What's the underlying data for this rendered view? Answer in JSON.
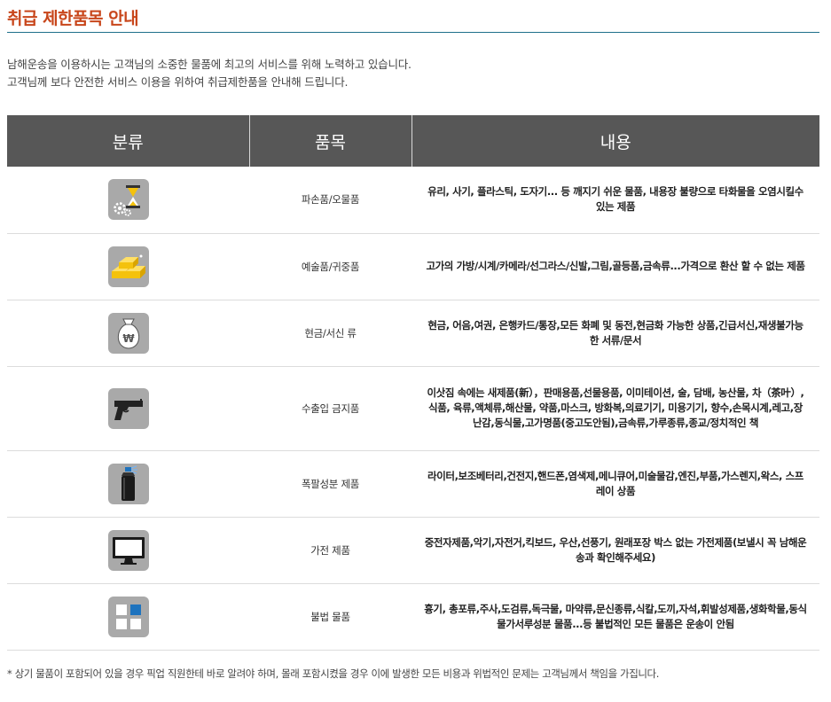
{
  "title": "취급 제한품목 안내",
  "intro": {
    "line1": "남해운송을 이용하시는 고객님의 소중한 물품에 최고의 서비스를 위해 노력하고 있습니다.",
    "line2": "고객님께 보다 안전한 서비스 이용을 위하여 취급제한품을 안내해 드립니다."
  },
  "table": {
    "headers": [
      "분류",
      "품목",
      "내용"
    ],
    "rows": [
      {
        "icon": "hourglass-gear-icon",
        "item": "파손품/오물품",
        "desc": "유리, 사기, 플라스틱, 도자기... 등 깨지기 쉬운 물품, 내용장 불량으로 타화물을 오염시킬수 있는 제품"
      },
      {
        "icon": "gold-bars-icon",
        "item": "예술품/귀중품",
        "desc": "고가의 가방/시계/카메라/선그라스/신발,그림,골등품,금속류...가격으로 환산 할 수 없는 제품"
      },
      {
        "icon": "money-bag-icon",
        "item": "현금/서신 류",
        "desc": "현금, 어음,여권, 은행카드/통장,모든 화폐 및 동전,현금화 가능한 상품,긴급서신,재생불가능한 서류/문서"
      },
      {
        "icon": "handgun-icon",
        "item": "수출입 금지품",
        "desc": "이삿짐 속에는 새제품(新），판매용품,선물용품, 이미테이션, 술, 담배, 농산물, 차（茶叶）,식품, 육류,액체류,해산물, 약품,마스크, 방화복,의료기기, 미용기기, 향수,손목시계,레고,장난감,동식물,고가명품(중고도안됨),금속류,가루종류,종교/정치적인 책"
      },
      {
        "icon": "spray-can-icon",
        "item": "폭팔성분 제품",
        "desc": "라이터,보조베터리,건전지,핸드폰,염색제,메니큐어,미술물감,엔진,부품,가스렌지,왁스, 스프레이 상품"
      },
      {
        "icon": "monitor-icon",
        "item": "가전 제품",
        "desc": "중전자제품,악기,자전거,킥보드, 우산,선풍기, 원래포장 박스 없는 가전제품(보낼시 꼭 남해운송과 확인해주세요)"
      },
      {
        "icon": "grid-squares-icon",
        "item": "불법 물품",
        "desc": "흉기, 총포류,주사,도검류,독극물, 마약류,문신종류,식칼,도끼,자석,휘발성제품,생화학물,동식물가서루성분 물품...등 불법적인 모든 물품은 운송이 안됨"
      }
    ]
  },
  "footnote": "* 상기 물품이 포함되어 있을 경우 픽업 직원한테 바로 알려야 하며, 몰래 포함시켰을 경우 이에 발생한 모든 비용과 위법적인 문제는 고객님께서 책임을 가집니다.",
  "colors": {
    "title": "#c8461b",
    "rule": "#1f6f8b",
    "header_bg": "#575757",
    "icon_bg": "#a9a9a9",
    "gold": "#f4c20d",
    "accent_blue": "#1e73be"
  }
}
